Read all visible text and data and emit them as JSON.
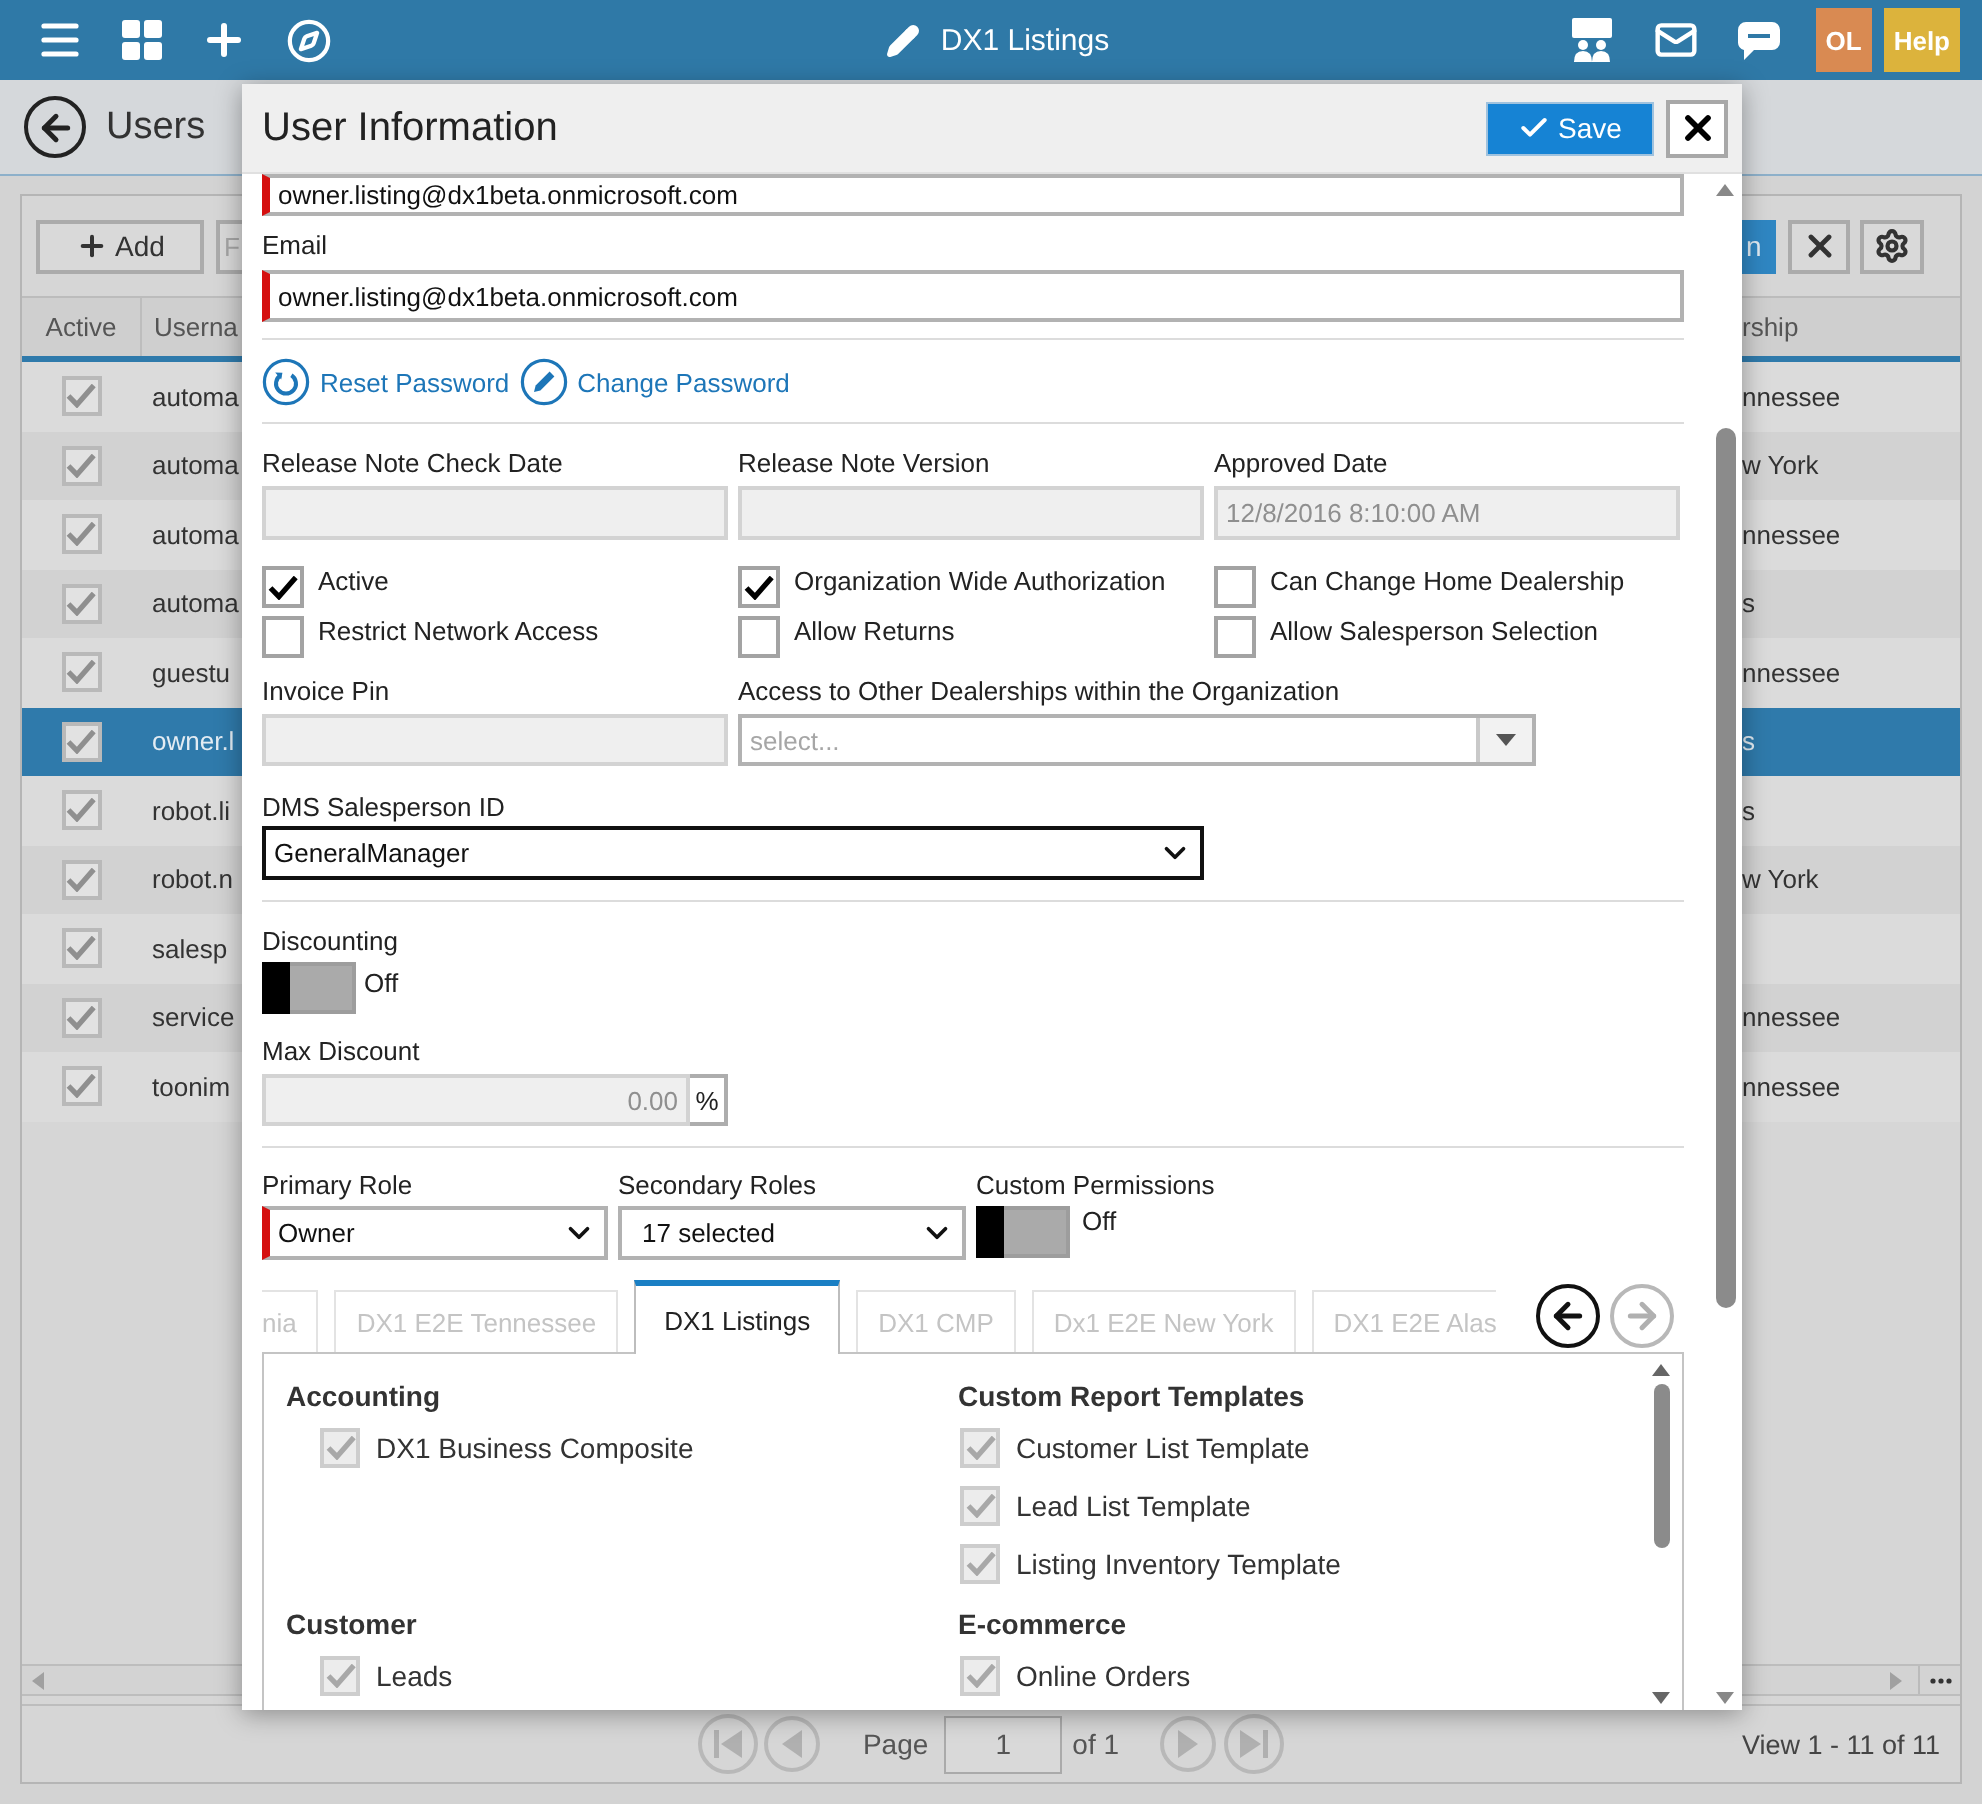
{
  "top_bar": {
    "title": "DX1 Listings",
    "user_initials": "OL",
    "help": "Help"
  },
  "page_header": {
    "title": "Users"
  },
  "toolbar": {
    "add_label": "Add",
    "filter_placeholder": "F",
    "search_label": "n"
  },
  "users_table": {
    "columns": [
      "Active",
      "Userna",
      "rship"
    ],
    "rows": [
      {
        "active": true,
        "username": "automa",
        "dealership": "nnessee",
        "selected": false
      },
      {
        "active": true,
        "username": "automa",
        "dealership": "w York",
        "selected": false
      },
      {
        "active": true,
        "username": "automa",
        "dealership": "nnessee",
        "selected": false
      },
      {
        "active": true,
        "username": "automa",
        "dealership": "s",
        "selected": false
      },
      {
        "active": true,
        "username": "guestu",
        "dealership": "nnessee",
        "selected": false
      },
      {
        "active": true,
        "username": "owner.l",
        "dealership": "s",
        "selected": true
      },
      {
        "active": true,
        "username": "robot.li",
        "dealership": "s",
        "selected": false
      },
      {
        "active": true,
        "username": "robot.n",
        "dealership": "w York",
        "selected": false
      },
      {
        "active": true,
        "username": "salesp",
        "selected": false
      },
      {
        "active": true,
        "username": "service",
        "dealership": "nnessee",
        "selected": false
      },
      {
        "active": true,
        "username": "toonim",
        "dealership": "nnessee",
        "selected": false
      }
    ]
  },
  "pager": {
    "page_label": "Page",
    "page": "1",
    "page_count": "of 1",
    "summary": "View 1 - 11 of 11"
  },
  "dialog": {
    "title": "User Information",
    "save_label": "Save",
    "username": {
      "value": "owner.listing@dx1beta.onmicrosoft.com",
      "required": true
    },
    "email": {
      "label": "Email",
      "value": "owner.listing@dx1beta.onmicrosoft.com",
      "required": true
    },
    "password_links": [
      {
        "kind": "reset",
        "label": "Reset Password"
      },
      {
        "kind": "change",
        "label": "Change Password"
      }
    ],
    "date_fields": [
      {
        "label": "Release Note Check Date",
        "disabled": true
      },
      {
        "label": "Release Note Version",
        "disabled": true
      },
      {
        "label": "Approved Date",
        "value": "12/8/2016 8:10:00 AM",
        "disabled": true
      }
    ],
    "flags": [
      {
        "label": "Active",
        "checked": true
      },
      {
        "label": "Organization Wide Authorization",
        "checked": true
      },
      {
        "label": "Can Change Home Dealership",
        "checked": false
      },
      {
        "label": "Restrict Network Access",
        "checked": false
      },
      {
        "label": "Allow Returns",
        "checked": false
      },
      {
        "label": "Allow Salesperson Selection",
        "checked": false
      }
    ],
    "invoice_pin": {
      "label": "Invoice Pin",
      "disabled": true
    },
    "other_dealerships": {
      "label": "Access to Other Dealerships within the Organization",
      "placeholder": "select..."
    },
    "dms_salesperson": {
      "label": "DMS Salesperson ID",
      "value": "GeneralManager"
    },
    "discounting": {
      "label": "Discounting",
      "on": false,
      "state_text": "Off"
    },
    "max_discount": {
      "label": "Max Discount",
      "value": "0.00",
      "unit": "%",
      "disabled": true
    },
    "primary_role": {
      "label": "Primary Role",
      "value": "Owner",
      "required": true
    },
    "secondary_roles": {
      "label": "Secondary Roles",
      "value": "17 selected"
    },
    "custom_permissions": {
      "label": "Custom Permissions",
      "on": false,
      "state_text": "Off"
    },
    "dealership_tabs": [
      {
        "label": "nia",
        "selected": false
      },
      {
        "label": "DX1 E2E Tennessee",
        "selected": false
      },
      {
        "label": "DX1 Listings",
        "selected": true
      },
      {
        "label": "DX1 CMP",
        "selected": false
      },
      {
        "label": "Dx1 E2E New York",
        "selected": false
      },
      {
        "label": "DX1 E2E Alas",
        "selected": false
      }
    ],
    "tab_nav": {
      "prev_disabled": false,
      "next_disabled": true
    },
    "permission_groups": [
      {
        "title": "Accounting",
        "items": [
          {
            "label": "DX1 Business Composite",
            "checked": true
          }
        ]
      },
      {
        "title": "Custom Report Templates",
        "items": [
          {
            "label": "Customer List Template",
            "checked": true
          },
          {
            "label": "Lead List Template",
            "checked": true
          },
          {
            "label": "Listing Inventory Template",
            "checked": true
          }
        ]
      },
      {
        "title": "Customer",
        "items": [
          {
            "label": "Leads",
            "checked": true
          }
        ]
      },
      {
        "title": "E-commerce",
        "items": [
          {
            "label": "Online Orders",
            "checked": true
          }
        ]
      }
    ]
  }
}
